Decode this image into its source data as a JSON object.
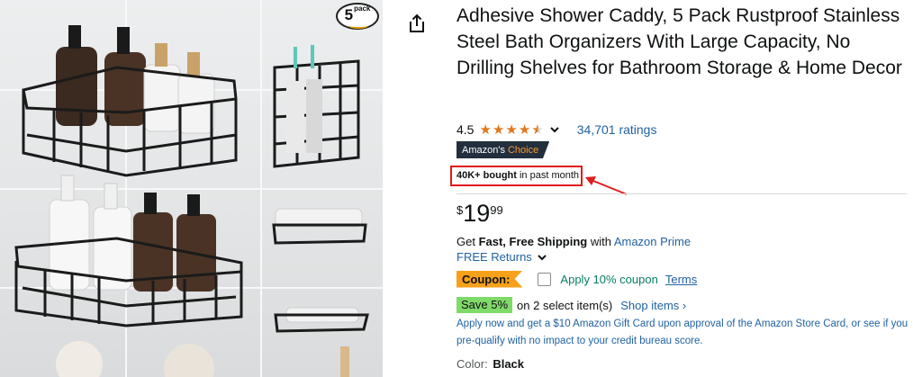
{
  "product": {
    "pack_badge_number": "5",
    "pack_badge_word": "pack",
    "title": "Adhesive Shower Caddy, 5 Pack Rustproof Stainless Steel Bath Organizers With Large Capacity, No Drilling Shelves for Bathroom Storage & Home Decor"
  },
  "rating": {
    "value": "4.5",
    "stars": 4.5,
    "count_text": "34,701 ratings"
  },
  "badge": {
    "prefix": "Amazon's",
    "choice": "Choice"
  },
  "bought": {
    "bold": "40K+ bought",
    "rest": " in past month"
  },
  "price": {
    "symbol": "$",
    "whole": "19",
    "fraction": "99"
  },
  "shipping": {
    "get": "Get ",
    "fast": "Fast, Free Shipping",
    "with": " with ",
    "prime": "Amazon Prime",
    "returns": "FREE Returns"
  },
  "coupon": {
    "label": "Coupon:",
    "apply_text": "Apply 10% coupon",
    "terms": "Terms"
  },
  "save": {
    "badge": "Save 5%",
    "text": "on 2 select item(s)",
    "link": "Shop items ›"
  },
  "gift_card": {
    "text": "Apply now and get a $10 Amazon Gift Card upon approval of the Amazon Store Card, or see if you pre-qualify with no impact to your credit bureau score."
  },
  "color": {
    "label": "Color:",
    "value": "Black"
  },
  "colors": {
    "link": "#2162A1",
    "star": "#DE7921",
    "highlight_box": "#e21b1b",
    "coupon_badge": "#F7A11B",
    "save_badge": "#7FDA69",
    "choice_badge_bg": "#232F3E",
    "choice_text": "#F69931"
  },
  "icons": {
    "share": "share-icon",
    "chevron": "chevron-down-icon",
    "arrow": "annotation-arrow-icon"
  }
}
